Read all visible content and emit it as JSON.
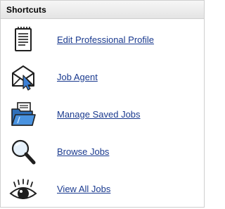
{
  "panel": {
    "title": "Shortcuts"
  },
  "shortcuts": [
    {
      "label": "Edit Professional Profile",
      "icon": "document-icon"
    },
    {
      "label": "Job Agent",
      "icon": "envelope-cursor-icon"
    },
    {
      "label": "Manage Saved Jobs",
      "icon": "folder-icon"
    },
    {
      "label": "Browse Jobs",
      "icon": "magnifier-icon"
    },
    {
      "label": "View All Jobs",
      "icon": "eye-icon"
    }
  ],
  "colors": {
    "link": "#1a3a8f",
    "header_bg": "#ececec",
    "border": "#cfcfcf"
  }
}
